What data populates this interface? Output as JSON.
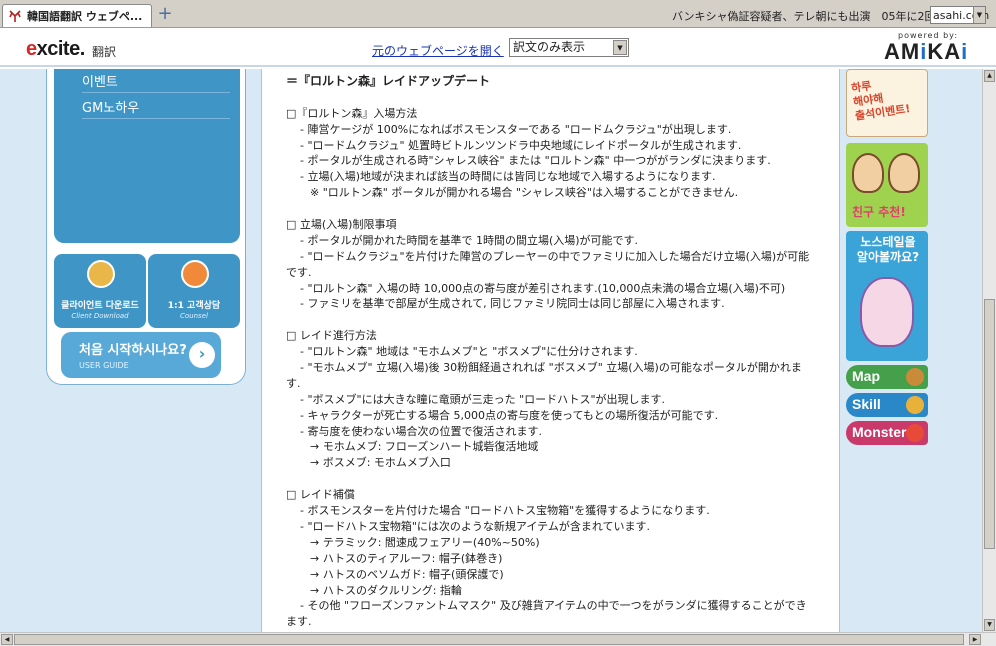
{
  "browser": {
    "tab_title": "韓国語翻訳 ウェブペ...",
    "new_tab_icon": "plus-icon",
    "ticker_text": "バンキシャ偽証容疑者、テレ朝にも出演　05年に2回",
    "ticker_source": "asahi.com"
  },
  "translator": {
    "logo": "excite",
    "label": "翻訳",
    "original_link": "元のウェブページを開く",
    "view_mode": "訳文のみ表示",
    "powered_by": "powered by:",
    "amikai": "AMiKAi"
  },
  "sidebar": {
    "menu_items": [
      "이벤트",
      "GM노하우"
    ],
    "quick_links": [
      {
        "label": "클라이언트 다운로드",
        "sub": "Client Download"
      },
      {
        "label": "1:1 고객상담",
        "sub": "Counsel"
      }
    ],
    "guide": {
      "title": "처음 시작하시나요?",
      "sub": "USER GUIDE",
      "arrow": "›"
    }
  },
  "article": {
    "title": "＝『ロルトン森』レイドアップデート",
    "lines": [
      {
        "t": "",
        "c": "blank"
      },
      {
        "t": "□『ロルトン森』入場方法",
        "c": ""
      },
      {
        "t": "- 陣営ケージが 100%になればボスモンスターである \"ロードムクラジュ\"が出現します.",
        "c": "ind1"
      },
      {
        "t": "- \"ロードムクラジュ\" 処置時ビトルンツンドラ中央地域にレイドポータルが生成されます.",
        "c": "ind1"
      },
      {
        "t": "- ポータルが生成される時\"シャレス峡谷\" または \"ロルトン森\" 中一つががランダに決まります.",
        "c": "ind1"
      },
      {
        "t": "- 立場(入場)地域が決まれば該当の時間には皆同じな地域で入場するようになります.",
        "c": "ind1"
      },
      {
        "t": "※ \"ロルトン森\" ポータルが開かれる場合 \"シャレス峡谷\"は入場することができません.",
        "c": "ind2"
      },
      {
        "t": "",
        "c": "blank"
      },
      {
        "t": "□ 立場(入場)制限事項",
        "c": ""
      },
      {
        "t": "- ポータルが開かれた時間を基準で 1時間の間立場(入場)が可能です.",
        "c": "ind1"
      },
      {
        "t": "- \"ロードムクラジュ\"を片付けた陣営のプレーヤーの中でファミリに加入した場合だけ立場(入場)が可能",
        "c": "ind1"
      },
      {
        "t": "です.",
        "c": ""
      },
      {
        "t": "- \"ロルトン森\" 入場の時 10,000点の寄与度が差引されます.(10,000点未満の場合立場(入場)不可)",
        "c": "ind1"
      },
      {
        "t": "- ファミリを基準で部屋が生成されて, 同じファミリ院同士は同じ部屋に入場されます.",
        "c": "ind1"
      },
      {
        "t": "",
        "c": "blank"
      },
      {
        "t": "□ レイド進行方法",
        "c": ""
      },
      {
        "t": "- \"ロルトン森\" 地域は \"モホムメブ\"と \"ボスメブ\"に仕分けされます.",
        "c": "ind1"
      },
      {
        "t": "- \"モホムメブ\" 立場(入場)後 30粉餌経過されれば \"ボスメブ\" 立場(入場)の可能なポータルが開かれま",
        "c": "ind1"
      },
      {
        "t": "す.",
        "c": ""
      },
      {
        "t": "- \"ボスメブ\"には大きな瞳に竜頭が三走った \"ロードハトス\"が出現します.",
        "c": "ind1"
      },
      {
        "t": "- キャラクターが死亡する場合 5,000点の寄与度を使ってもとの場所復活が可能です.",
        "c": "ind1"
      },
      {
        "t": "- 寄与度を使わない場合次の位置で復活されます.",
        "c": "ind1"
      },
      {
        "t": "→ モホムメブ: フローズンハート城砦復活地域",
        "c": "ind2"
      },
      {
        "t": "→ ボスメブ: モホムメブ入口",
        "c": "ind2"
      },
      {
        "t": "",
        "c": "blank"
      },
      {
        "t": "□ レイド補償",
        "c": ""
      },
      {
        "t": "- ボスモンスターを片付けた場合 \"ロードハトス宝物箱\"を獲得するようになります.",
        "c": "ind1"
      },
      {
        "t": "- \"ロードハトス宝物箱\"には次のような新規アイテムが含まれています.",
        "c": "ind1"
      },
      {
        "t": "→ テラミック: 閻速成フェアリー(40%~50%)",
        "c": "ind2"
      },
      {
        "t": "→ ハトスのティアルーフ: 帽子(鉢巻き)",
        "c": "ind2"
      },
      {
        "t": "→ ハトスのベソムガド: 帽子(頭保護で)",
        "c": "ind2"
      },
      {
        "t": "→ ハトスのダクルリング: 指輪",
        "c": "ind2"
      },
      {
        "t": "- その他 \"フローズンファントムマスク\" 及び雑貨アイテムの中で一つをがランダに獲得することができ",
        "c": "ind1"
      },
      {
        "t": "ます.",
        "c": ""
      }
    ]
  },
  "banners": {
    "event": "하루\n해야해\n출석이벤트!",
    "pair": "친구 추천!",
    "nostale": "노스테일을\n알아볼까요?",
    "map": "Map",
    "skill": "Skill",
    "monster": "Monster"
  }
}
